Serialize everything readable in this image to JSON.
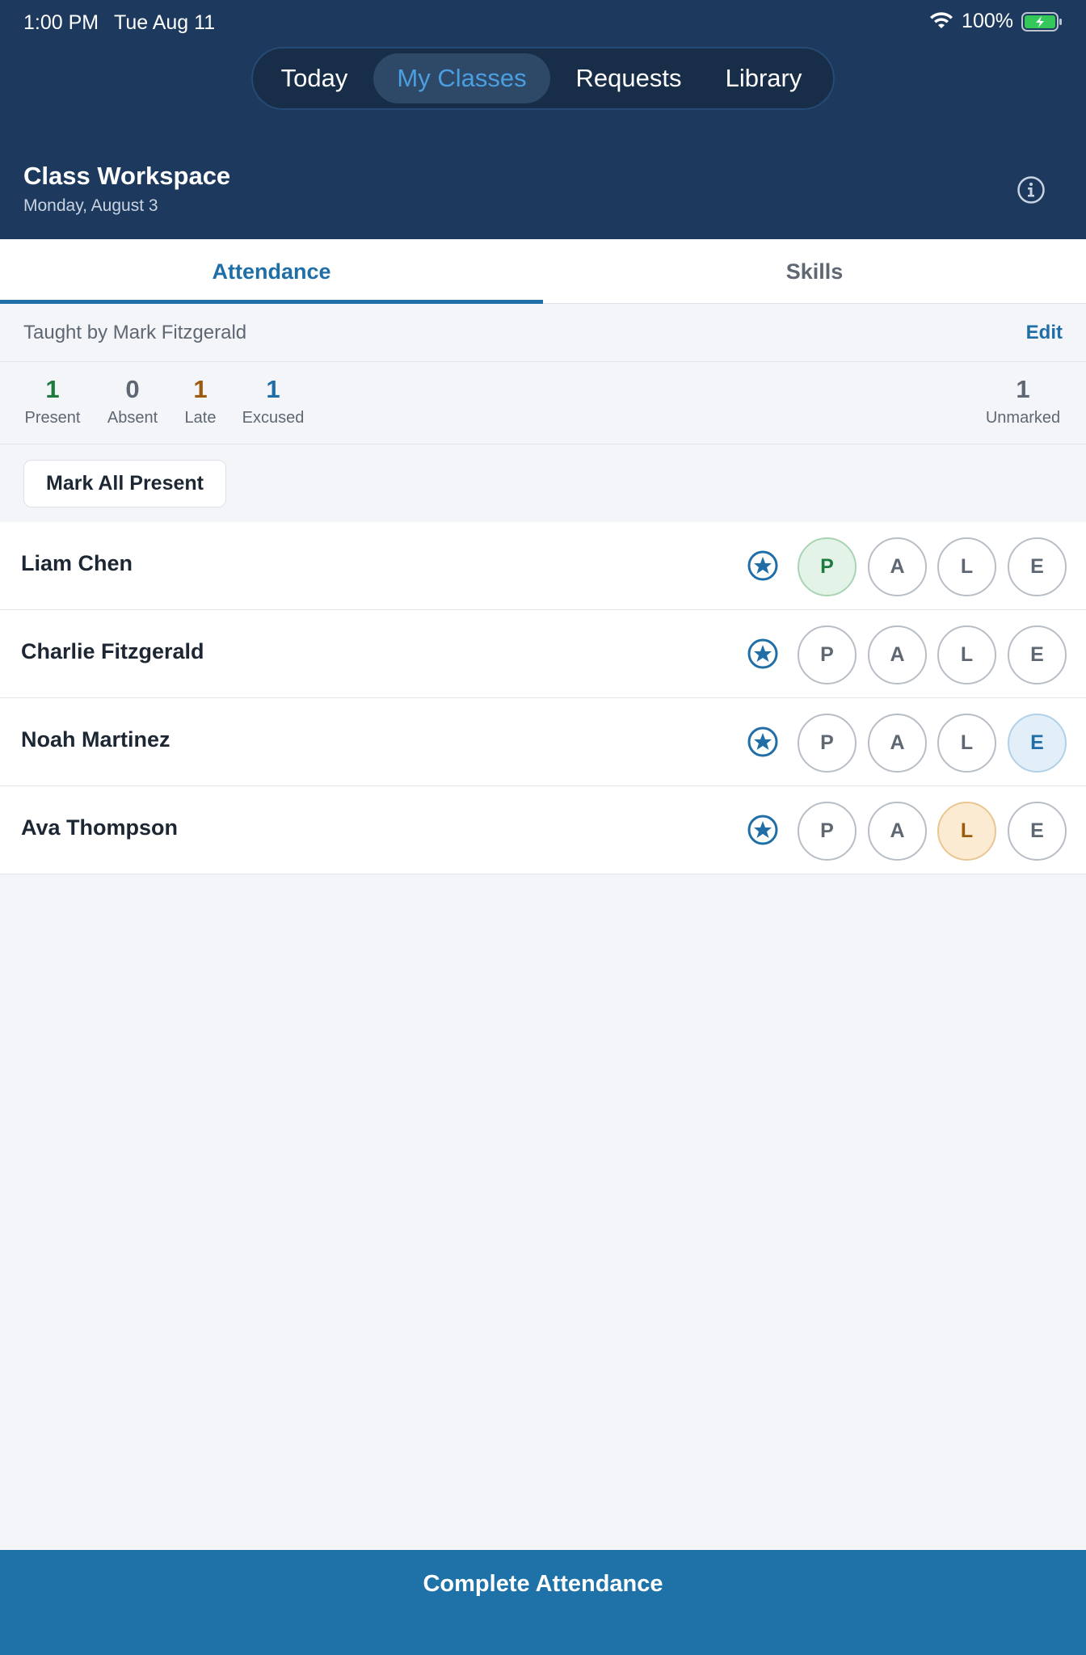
{
  "status_bar": {
    "time": "1:00 PM",
    "date": "Tue Aug 11",
    "battery": "100%"
  },
  "nav": {
    "tabs": [
      {
        "label": "Today"
      },
      {
        "label": "My Classes"
      },
      {
        "label": "Requests"
      },
      {
        "label": "Library"
      }
    ],
    "active": "My Classes"
  },
  "workspace": {
    "title": "Class Workspace",
    "date": "Monday, August 3"
  },
  "tabs": [
    {
      "label": "Attendance"
    },
    {
      "label": "Skills"
    }
  ],
  "teacher": {
    "text": "Taught by Mark Fitzgerald",
    "edit_label": "Edit"
  },
  "counts": {
    "present": {
      "value": "1",
      "label": "Present"
    },
    "absent": {
      "value": "0",
      "label": "Absent"
    },
    "late": {
      "value": "1",
      "label": "Late"
    },
    "excused": {
      "value": "1",
      "label": "Excused"
    },
    "unmarked": {
      "value": "1",
      "label": "Unmarked"
    }
  },
  "mark_all_label": "Mark All Present",
  "attendance_options": [
    "P",
    "A",
    "L",
    "E"
  ],
  "students": [
    {
      "name": "Liam Chen",
      "status": "P"
    },
    {
      "name": "Charlie Fitzgerald",
      "status": ""
    },
    {
      "name": "Noah Martinez",
      "status": "E"
    },
    {
      "name": "Ava Thompson",
      "status": "L"
    }
  ],
  "footer": {
    "complete_label": "Complete Attendance"
  },
  "colors": {
    "header_bg": "#1d3a5e",
    "accent": "#1f6ea7",
    "present": "#1e7a3e",
    "late": "#9a5b0f",
    "excused": "#1f6ea7",
    "absent": "#5e6772"
  }
}
